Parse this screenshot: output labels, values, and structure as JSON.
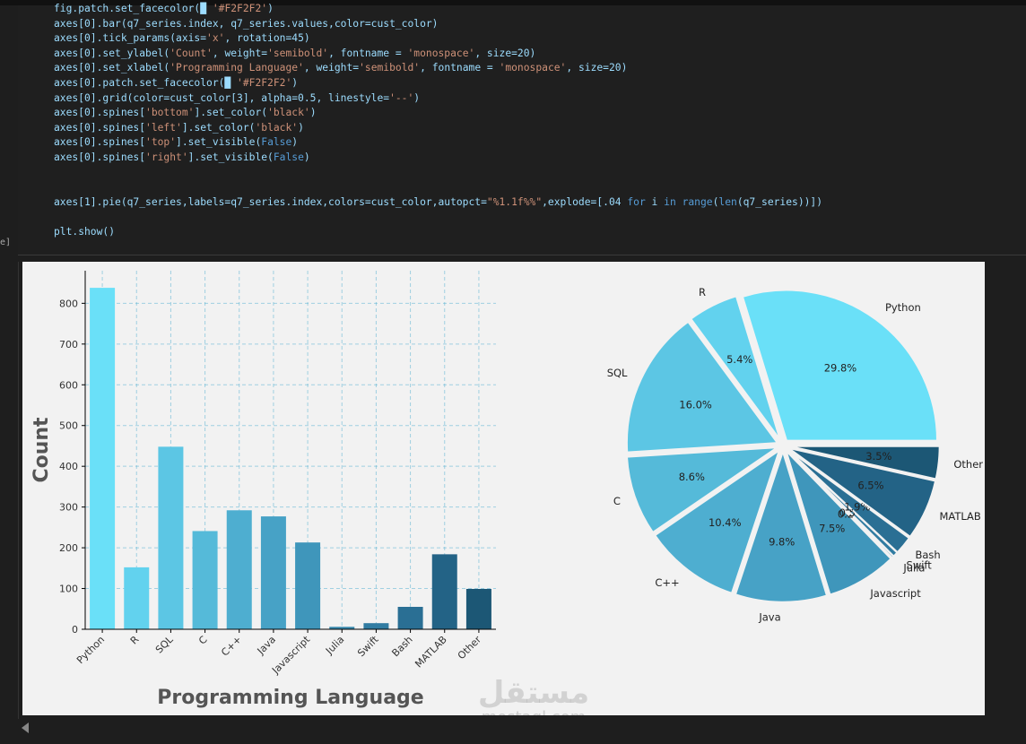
{
  "code_lines": [
    "fig.patch.set_facecolor(█ '#F2F2F2')",
    "axes[0].bar(q7_series.index, q7_series.values,color=cust_color)",
    "axes[0].tick_params(axis='x', rotation=45)",
    "axes[0].set_ylabel('Count', weight='semibold', fontname = 'monospace', size=20)",
    "axes[0].set_xlabel('Programming Language', weight='semibold', fontname = 'monospace', size=20)",
    "axes[0].patch.set_facecolor(█ '#F2F2F2')",
    "axes[0].grid(color=cust_color[3], alpha=0.5, linestyle='--')",
    "axes[0].spines['bottom'].set_color('black')",
    "axes[0].spines['left'].set_color('black')",
    "axes[0].spines['top'].set_visible(False)",
    "axes[0].spines['right'].set_visible(False)",
    "",
    "",
    "axes[1].pie(q7_series,labels=q7_series.index,colors=cust_color,autopct=\"%1.1f%%\",explode=[.04 for i in range(len(q7_series))])",
    "",
    "plt.show()"
  ],
  "gutter": "e]",
  "watermark": {
    "arabic": "مستقل",
    "latin": "mostaql.com"
  },
  "chart_data": [
    {
      "type": "bar",
      "categories": [
        "Python",
        "R",
        "SQL",
        "C",
        "C++",
        "Java",
        "Javascript",
        "Julia",
        "Swift",
        "Bash",
        "MATLAB",
        "Other"
      ],
      "values": [
        838,
        152,
        448,
        241,
        292,
        277,
        213,
        6,
        15,
        55,
        184,
        99
      ],
      "xlabel": "Programming Language",
      "ylabel": "Count",
      "ylim": [
        0,
        880
      ],
      "yticks": [
        0,
        100,
        200,
        300,
        400,
        500,
        600,
        700,
        800
      ],
      "grid": true
    },
    {
      "type": "pie",
      "labels": [
        "Python",
        "R",
        "SQL",
        "C",
        "C++",
        "Java",
        "Javascript",
        "Julia",
        "Swift",
        "Bash",
        "MATLAB",
        "Other"
      ],
      "values": [
        838,
        152,
        448,
        241,
        292,
        277,
        213,
        6,
        15,
        55,
        184,
        99
      ],
      "pct_labels": [
        "29.8%",
        "5.4%",
        "16.0%",
        "8.6%",
        "10.4%",
        "9.8%",
        "7.5%",
        "0.2%",
        "0.5%",
        "1.9%",
        "6.5%",
        "3.5%"
      ],
      "explode": 0.04
    }
  ],
  "colors": [
    "#6ae0f8",
    "#62d2ee",
    "#5cc6e4",
    "#55bad9",
    "#4eaed0",
    "#47a2c6",
    "#3f96bb",
    "#3888ad",
    "#317ca2",
    "#2a6f94",
    "#236386",
    "#1c5775"
  ]
}
